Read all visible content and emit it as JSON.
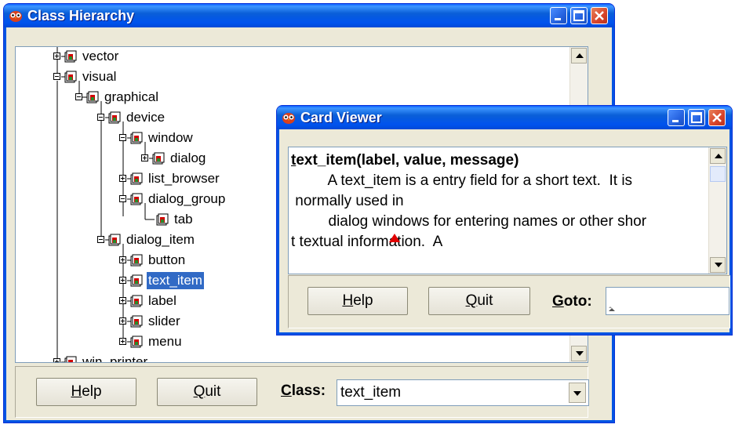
{
  "class_window": {
    "title": "Class Hierarchy",
    "tree": [
      {
        "label": "vector",
        "toggle": "plus"
      },
      {
        "label": "visual",
        "toggle": "minus"
      },
      {
        "label": "graphical",
        "toggle": "minus"
      },
      {
        "label": "device",
        "toggle": "minus"
      },
      {
        "label": "window",
        "toggle": "minus"
      },
      {
        "label": "dialog",
        "toggle": "plus"
      },
      {
        "label": "list_browser",
        "toggle": "plus"
      },
      {
        "label": "dialog_group",
        "toggle": "minus"
      },
      {
        "label": "tab",
        "toggle": "none"
      },
      {
        "label": "dialog_item",
        "toggle": "minus"
      },
      {
        "label": "button",
        "toggle": "plus"
      },
      {
        "label": "text_item",
        "toggle": "plus",
        "selected": true
      },
      {
        "label": "label",
        "toggle": "plus"
      },
      {
        "label": "slider",
        "toggle": "plus"
      },
      {
        "label": "menu",
        "toggle": "plus"
      },
      {
        "label": "win_printer",
        "toggle": "plus"
      }
    ],
    "help_button": {
      "mnemonic": "H",
      "rest": "elp"
    },
    "quit_button": {
      "mnemonic": "Q",
      "rest": "uit"
    },
    "class_label": {
      "mnemonic": "C",
      "rest": "lass:"
    },
    "class_value": "text_item"
  },
  "card_window": {
    "title": "Card Viewer",
    "heading_first": "t",
    "heading_rest": "ext_item(label, value, message)",
    "lines": [
      "         A text_item is a entry field for a short text.  It is",
      " normally used in",
      "         dialog windows for entering names or other shor",
      "t textual information.  A"
    ],
    "help_button": {
      "mnemonic": "H",
      "rest": "elp"
    },
    "quit_button": {
      "mnemonic": "Q",
      "rest": "uit"
    },
    "goto_label": {
      "mnemonic": "G",
      "rest": "oto:"
    },
    "goto_value": ""
  },
  "colors": {
    "titlebar": "#0054e3",
    "selection": "#316ac5",
    "caret": "#e00000"
  }
}
